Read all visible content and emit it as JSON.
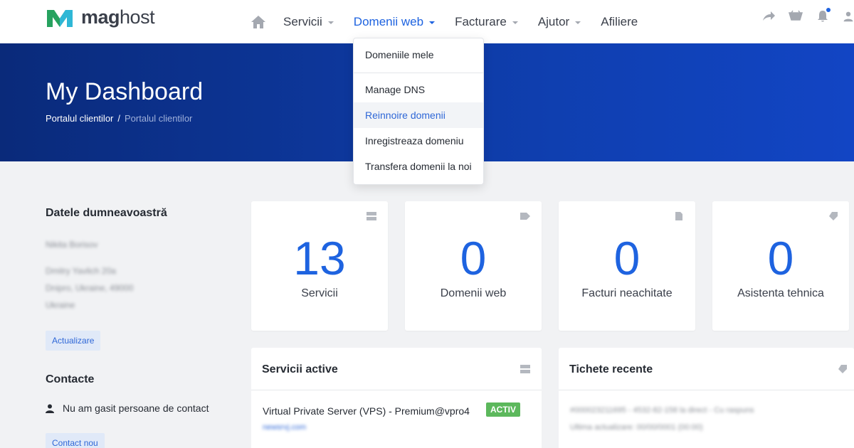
{
  "brand": {
    "name_bold": "mag",
    "name_light": "host",
    "mark_color": "#1f9a5a",
    "mark_color_2": "#2fb7d6"
  },
  "nav": {
    "home_icon": "home-icon",
    "items": [
      {
        "label": "Servicii",
        "caret": true,
        "active": false
      },
      {
        "label": "Domenii web",
        "caret": true,
        "active": true
      },
      {
        "label": "Facturare",
        "caret": true,
        "active": false
      },
      {
        "label": "Ajutor",
        "caret": true,
        "active": false
      },
      {
        "label": "Afiliere",
        "caret": false,
        "active": false
      }
    ],
    "right_icons": [
      "share-icon",
      "cart-icon",
      "bell-icon",
      "user-icon"
    ]
  },
  "dropdown": {
    "items": [
      {
        "label": "Domeniile mele"
      },
      {
        "label": "Manage DNS"
      },
      {
        "label": "Reinnoire domenii",
        "hover": true
      },
      {
        "label": "Inregistreaza domeniu"
      },
      {
        "label": "Transfera domenii la noi"
      }
    ]
  },
  "hero": {
    "title": "My Dashboard",
    "breadcrumb": [
      "Portalul clientilor",
      "Portalul clientilor"
    ]
  },
  "sidebar": {
    "details_heading": "Datele dumneavoastră",
    "details_lines": [
      "Nikita Borisov",
      "Dmitry Yavlich 20a",
      "Dnipro, Ukraine, 49000",
      "Ukraine"
    ],
    "update_button": "Actualizare",
    "contacts_heading": "Contacte",
    "no_contacts": "Nu am gasit persoane de contact",
    "new_contact_button": "Contact nou"
  },
  "stats": [
    {
      "value": "13",
      "label": "Servicii",
      "icon": "server-icon"
    },
    {
      "value": "0",
      "label": "Domenii web",
      "icon": "tag-icon"
    },
    {
      "value": "0",
      "label": "Facturi neachitate",
      "icon": "document-icon"
    },
    {
      "value": "0",
      "label": "Asistenta tehnica",
      "icon": "ticket-icon"
    }
  ],
  "active_services": {
    "heading": "Servicii active",
    "service_name": "Virtual Private Server (VPS) - Premium@vpro4",
    "service_link": "newsrvj.com",
    "badge": "ACTIV"
  },
  "recent_tickets": {
    "heading": "Tichete recente",
    "ticket_title": "#000023211695 - 4532-82-158 la direct - Cu raspuns",
    "ticket_meta": "Ultima actualizare: 00/00/0001 (00:00)"
  },
  "colors": {
    "accent": "#1e63e0",
    "hero": "#0a2a7a",
    "badge_green": "#5cb85c"
  }
}
